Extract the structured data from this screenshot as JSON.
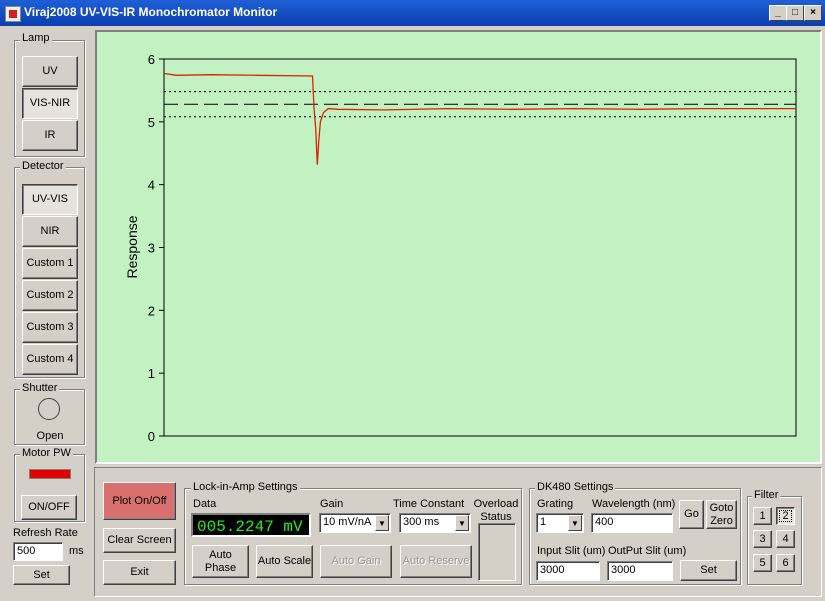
{
  "window": {
    "title": "Viraj2008 UV-VIS-IR Monochromator Monitor",
    "minimize": "_",
    "maximize": "□",
    "close": "×"
  },
  "lamp": {
    "label": "Lamp",
    "buttons": [
      "UV",
      "VIS-NIR",
      "IR"
    ],
    "selected": "VIS-NIR"
  },
  "detector": {
    "label": "Detector",
    "buttons": [
      "UV-VIS",
      "NIR",
      "Custom 1",
      "Custom 2",
      "Custom 3",
      "Custom 4"
    ],
    "selected": "UV-VIS"
  },
  "shutter": {
    "label": "Shutter",
    "state": "Open"
  },
  "motor": {
    "label": "Motor PW",
    "button": "ON/OFF",
    "indicator_color": "#e00000"
  },
  "refresh": {
    "label": "Refresh Rate",
    "value": "500",
    "unit": "ms",
    "set_label": "Set"
  },
  "plot": {
    "background": "#c2f2c2",
    "line_color": "#e02000"
  },
  "chart_data": {
    "type": "line",
    "title": "",
    "xlabel": "",
    "ylabel": "Response",
    "ylim": [
      0,
      6
    ],
    "xlim": [
      0,
      400
    ],
    "yticks": [
      "0",
      "1",
      "2",
      "3",
      "4",
      "5",
      "6"
    ],
    "grid": false,
    "series": [
      {
        "values": [
          [
            0,
            5.77
          ],
          [
            8,
            5.74
          ],
          [
            30,
            5.75
          ],
          [
            60,
            5.74
          ],
          [
            94,
            5.73
          ],
          [
            95,
            5.2
          ],
          [
            96,
            4.9
          ],
          [
            97,
            4.32
          ],
          [
            98,
            4.7
          ],
          [
            99,
            5.0
          ],
          [
            101,
            5.15
          ],
          [
            104,
            5.21
          ],
          [
            110,
            5.2
          ],
          [
            140,
            5.19
          ],
          [
            180,
            5.21
          ],
          [
            220,
            5.2
          ],
          [
            260,
            5.21
          ],
          [
            300,
            5.2
          ],
          [
            340,
            5.21
          ],
          [
            380,
            5.21
          ],
          [
            400,
            5.21
          ]
        ]
      }
    ],
    "reference_lines": [
      {
        "y": 5.28,
        "style": "dashed"
      },
      {
        "y": 5.48,
        "style": "dotted"
      },
      {
        "y": 5.08,
        "style": "dotted"
      }
    ]
  },
  "controls": {
    "plot_onoff": "Plot On/Off",
    "clear_screen": "Clear Screen",
    "exit": "Exit"
  },
  "lockin": {
    "label": "Lock-in-Amp Settings",
    "data_label": "Data",
    "data_value": "005.2247 mV",
    "gain_label": "Gain",
    "gain_value": "10 mV/nA",
    "tc_label": "Time Constant",
    "tc_value": "300 ms",
    "overload_label": "Overload Status",
    "auto_phase": "Auto Phase",
    "auto_scale": "Auto Scale",
    "auto_gain": "Auto Gain",
    "auto_reserve": "Auto Reserve"
  },
  "dk480": {
    "label": "DK480 Settings",
    "grating_label": "Grating",
    "grating_value": "1",
    "wavelength_label": "Wavelength (nm)",
    "wavelength_value": "400",
    "go": "Go",
    "goto_zero": "Goto Zero",
    "input_slit_label": "Input Slit (um)",
    "input_slit_value": "3000",
    "output_slit_label": "OutPut Slit (um)",
    "output_slit_value": "3000",
    "set": "Set"
  },
  "filter": {
    "label": "Filter",
    "buttons": [
      "1",
      "2",
      "3",
      "4",
      "5",
      "6"
    ],
    "selected": "2"
  }
}
